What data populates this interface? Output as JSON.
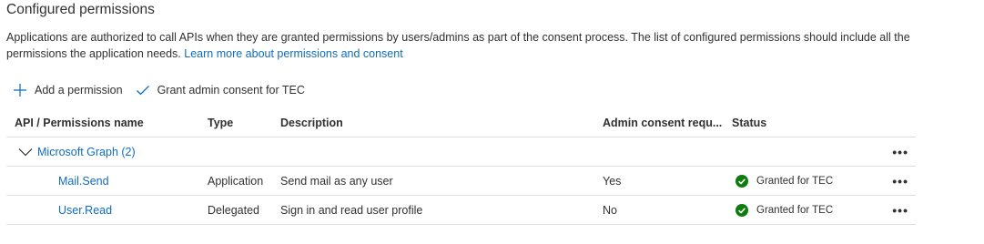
{
  "section": {
    "title": "Configured permissions",
    "description": "Applications are authorized to call APIs when they are granted permissions by users/admins as part of the consent process. The list of configured permissions should include all the permissions the application needs.",
    "learn_more": "Learn more about permissions and consent"
  },
  "toolbar": {
    "add_permission": "Add a permission",
    "grant_consent": "Grant admin consent for TEC"
  },
  "table": {
    "headers": {
      "api": "API / Permissions name",
      "type": "Type",
      "description": "Description",
      "admin_consent": "Admin consent requ...",
      "status": "Status"
    },
    "group": {
      "label": "Microsoft Graph (2)",
      "more": "•••"
    },
    "rows": [
      {
        "name": "Mail.Send",
        "type": "Application",
        "description": "Send mail as any user",
        "admin_consent": "Yes",
        "status": "Granted for TEC",
        "more": "•••"
      },
      {
        "name": "User.Read",
        "type": "Delegated",
        "description": "Sign in and read user profile",
        "admin_consent": "No",
        "status": "Granted for TEC",
        "more": "•••"
      }
    ]
  },
  "colors": {
    "link": "#0f6cbd",
    "success": "#107c10",
    "border": "#e1dfdd",
    "text": "#323130"
  },
  "icons": {
    "add": "plus-icon",
    "grant": "checkmark-icon",
    "expand": "chevron-down-icon",
    "status": "check-circle-icon"
  }
}
